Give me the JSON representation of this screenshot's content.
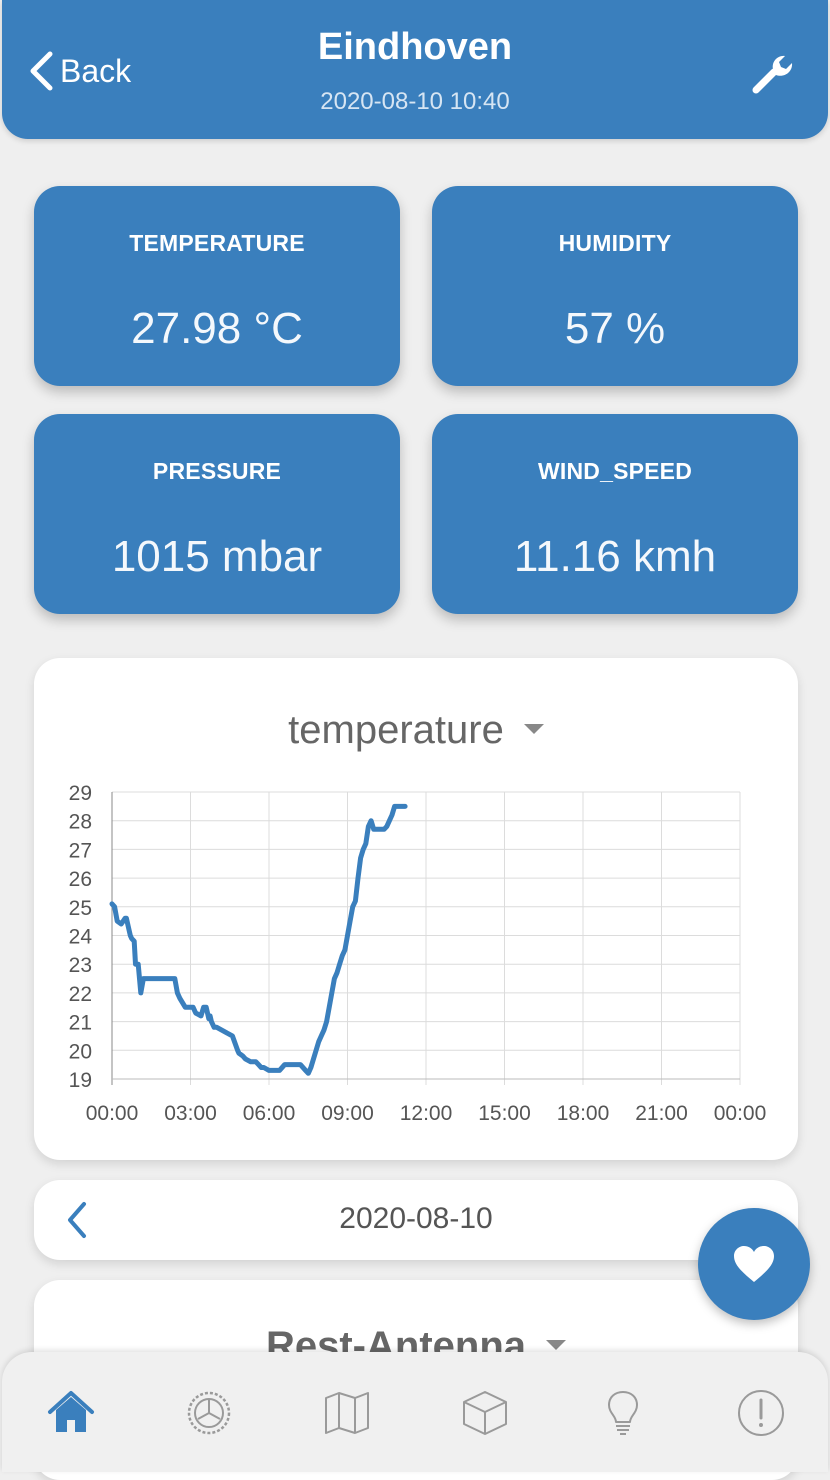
{
  "header": {
    "back_label": "Back",
    "title": "Eindhoven",
    "timestamp": "2020-08-10 10:40"
  },
  "tiles": [
    {
      "label": "TEMPERATURE",
      "value": "27.98 °C"
    },
    {
      "label": "HUMIDITY",
      "value": "57 %"
    },
    {
      "label": "PRESSURE",
      "value": "1015 mbar"
    },
    {
      "label": "WIND_SPEED",
      "value": "11.16 kmh"
    }
  ],
  "chart_data": {
    "type": "line",
    "title": "temperature",
    "xlabel": "",
    "ylabel": "",
    "x_ticks": [
      "00:00",
      "03:00",
      "06:00",
      "09:00",
      "12:00",
      "15:00",
      "18:00",
      "21:00",
      "00:00"
    ],
    "y_ticks": [
      19,
      20,
      21,
      22,
      23,
      24,
      25,
      26,
      27,
      28,
      29
    ],
    "xlim_hours": [
      0,
      24
    ],
    "ylim": [
      19,
      29
    ],
    "grid": true,
    "color": "#3a7fbd",
    "series": [
      {
        "x_hours": [
          0.0,
          0.1,
          0.2,
          0.35,
          0.5,
          0.55,
          0.7,
          0.75,
          0.85,
          0.9,
          1.0,
          1.1,
          1.2,
          1.3,
          1.4,
          1.45,
          1.5,
          1.6,
          2.0,
          2.4,
          2.5,
          2.6,
          2.8,
          2.9,
          3.0,
          3.1,
          3.2,
          3.4,
          3.5,
          3.6,
          3.7,
          3.75,
          3.8,
          3.9,
          4.0,
          4.2,
          4.4,
          4.6,
          4.8,
          4.85,
          5.0,
          5.1,
          5.3,
          5.5,
          5.6,
          5.7,
          5.8,
          6.0,
          6.2,
          6.4,
          6.6,
          6.8,
          7.0,
          7.2,
          7.4,
          7.5,
          7.6,
          7.7,
          7.8,
          7.9,
          8.0,
          8.1,
          8.2,
          8.3,
          8.4,
          8.5,
          8.6,
          8.7,
          8.8,
          8.9,
          9.0,
          9.1,
          9.2,
          9.3,
          9.4,
          9.5,
          9.6,
          9.7,
          9.8,
          9.9,
          10.0,
          10.1,
          10.2,
          10.3,
          10.4,
          10.5,
          10.6,
          10.7,
          10.8,
          10.9,
          11.0,
          11.1,
          11.2
        ],
        "y_values": [
          25.1,
          25.0,
          24.5,
          24.4,
          24.6,
          24.6,
          24.0,
          23.9,
          23.8,
          23.0,
          23.0,
          22.0,
          22.5,
          22.5,
          22.5,
          22.5,
          22.5,
          22.5,
          22.5,
          22.5,
          22.0,
          21.8,
          21.5,
          21.5,
          21.5,
          21.5,
          21.3,
          21.2,
          21.5,
          21.5,
          21.1,
          21.2,
          21.0,
          20.8,
          20.8,
          20.7,
          20.6,
          20.5,
          20.0,
          19.9,
          19.8,
          19.7,
          19.6,
          19.6,
          19.5,
          19.4,
          19.4,
          19.3,
          19.3,
          19.3,
          19.5,
          19.5,
          19.5,
          19.5,
          19.3,
          19.2,
          19.4,
          19.7,
          20.0,
          20.3,
          20.5,
          20.7,
          21.0,
          21.5,
          22.0,
          22.5,
          22.7,
          23.0,
          23.3,
          23.5,
          24.0,
          24.5,
          25.0,
          25.2,
          26.0,
          26.7,
          27.0,
          27.2,
          27.8,
          28.0,
          27.7,
          27.7,
          27.7,
          27.7,
          27.7,
          27.8,
          28.0,
          28.2,
          28.5,
          28.5,
          28.5,
          28.5,
          28.5
        ]
      }
    ]
  },
  "date_nav": {
    "date": "2020-08-10"
  },
  "second_card": {
    "title": "Rest-Antenna"
  },
  "tabbar": {
    "items": [
      "home-icon",
      "dashboard-gauge-icon",
      "map-icon",
      "cube-icon",
      "lightbulb-icon",
      "alert-icon"
    ],
    "active_color": "#3a7fbd",
    "inactive_color": "#9a9a9a"
  }
}
